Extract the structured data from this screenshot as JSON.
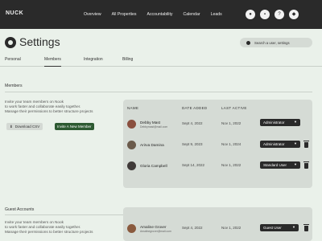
{
  "brand": "NUCK",
  "nav": [
    "Overview",
    "All Properties",
    "Accountability",
    "Calendar",
    "Leads"
  ],
  "page_title": "Settings",
  "search_placeholder": "Search a user, settings",
  "tabs": [
    "Personal",
    "Members",
    "Integration",
    "Billing"
  ],
  "active_tab": "Members",
  "members": {
    "section_title": "Members",
    "description": "Invite your team members on Nook\nto work faster and collaborate easily together.\nManage their permissions to better structure projects",
    "download_label": "Download CSV",
    "invite_label": "Invite A New Member",
    "columns": [
      "NAME",
      "DATE ADDED",
      "LAST ACTIVE"
    ],
    "rows": [
      {
        "name": "Debby Mast",
        "email": "Debbymast@mail.com",
        "date_added": "Sept 4, 2022",
        "last_active": "Nov 1, 2022",
        "role": "Administrator"
      },
      {
        "name": "Arirva Damina",
        "email": "",
        "date_added": "Sept 9, 2023",
        "last_active": "Nov 1, 2024",
        "role": "Administrator"
      },
      {
        "name": "Gloria Campbell",
        "email": "",
        "date_added": "Sept 14, 2022",
        "last_active": "Nov 1, 2022",
        "role": "Standard User"
      }
    ]
  },
  "guest": {
    "section_title": "Guest Accounts",
    "description": "Invite your team members on Nook\nto work faster and collaborate easily together.\nManage their permissions to better structure projects",
    "rows": [
      {
        "name": "Amaline Grover",
        "email": "Amalinegrover@mail.com",
        "date_added": "Sept 4, 2022",
        "last_active": "Nov 1, 2022",
        "role": "Guest User"
      }
    ]
  }
}
